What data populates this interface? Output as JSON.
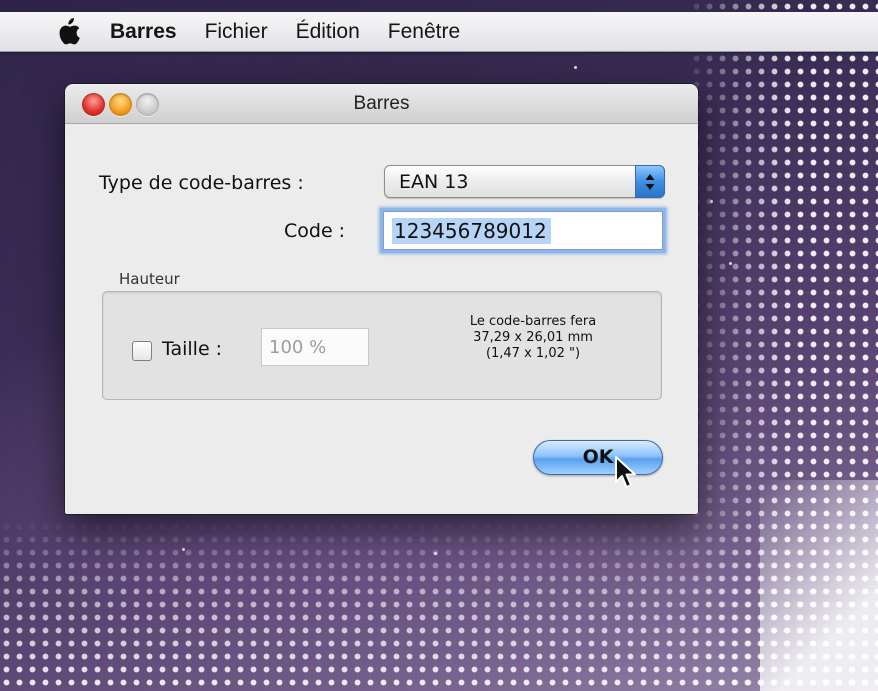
{
  "menubar": {
    "apple_icon": "apple-logo-icon",
    "items": [
      "Barres",
      "Fichier",
      "Édition",
      "Fenêtre"
    ]
  },
  "window": {
    "title": "Barres",
    "buttons": [
      "close",
      "minimize",
      "zoom"
    ]
  },
  "form": {
    "type_label": "Type de code-barres :",
    "type_value": "EAN 13",
    "code_label": "Code :",
    "code_value": "123456789012",
    "height_group_label": "Hauteur",
    "size_checkbox_checked": false,
    "size_label": "Taille :",
    "size_value": "100 %",
    "info_line1": "Le code-barres fera",
    "info_line2": "37,29 x 26,01 mm",
    "info_line3": "(1,47 x 1,02 \")",
    "ok_label": "OK"
  },
  "colors": {
    "accent_blue": "#5aa1f0",
    "selection_blue": "#b6d4f7",
    "close_red": "#e0332c",
    "minimize_yellow": "#f2a01f"
  }
}
